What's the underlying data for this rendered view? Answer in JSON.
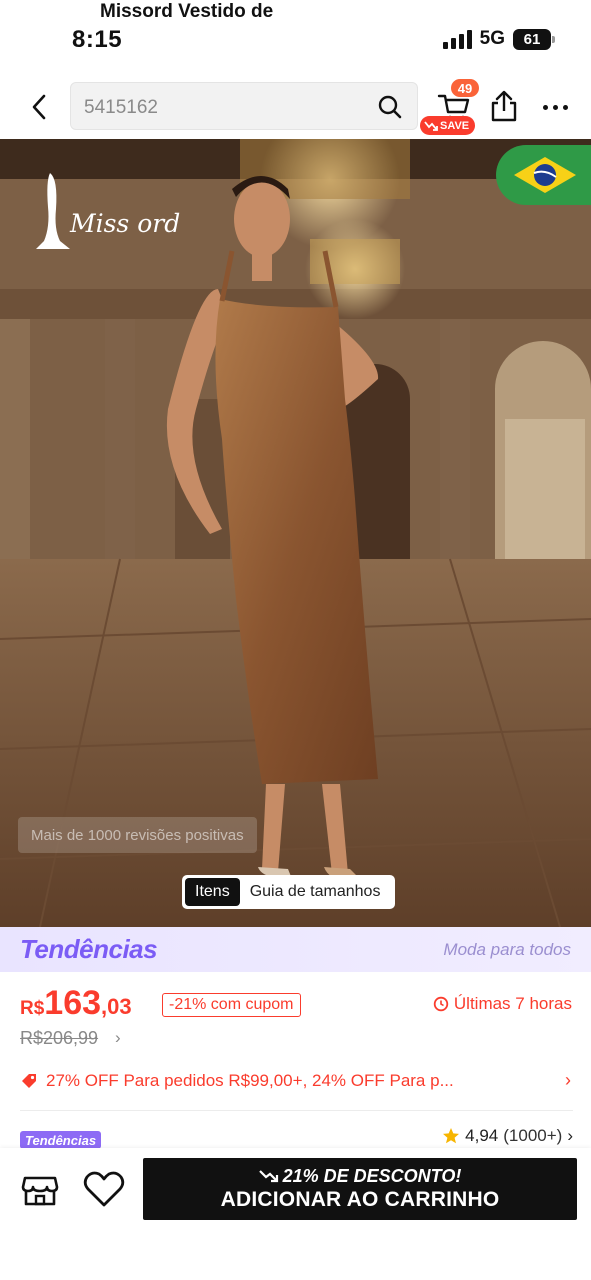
{
  "status_bar": {
    "time": "8:15",
    "network": "5G",
    "battery": "61"
  },
  "nav": {
    "search_text": "5415162",
    "cart_count": "49",
    "save_badge": "SAVE"
  },
  "hero": {
    "brand": "Miss ord",
    "reviews_text": "Mais de 1000 revisões positivas",
    "tabs": [
      "Itens",
      "Guia de tamanhos"
    ]
  },
  "trends_banner": {
    "logo": "Tendências",
    "tagline": "Moda para todos"
  },
  "price": {
    "currency": "R$",
    "integer": "163",
    "cents": ",03",
    "coupon": "-21% com cupom",
    "timer": "Últimas 7 horas",
    "original": "R$206,99",
    "original_chevron": "›"
  },
  "promo": {
    "text": "27% OFF Para pedidos R$99,00+,  24% OFF Para p...",
    "chevron": "›"
  },
  "product": {
    "tag": "Tendências",
    "title": "Missord Vestido de",
    "rating": "4,94",
    "rating_count": "(1000+)",
    "rating_chevron": "›"
  },
  "bottom_bar": {
    "discount_text": "21% DE DESCONTO!",
    "add_to_cart": "ADICIONAR AO CARRINHO"
  },
  "colors": {
    "accent": "#fa3c2d",
    "trends": "#7b5cf5",
    "button": "#111111"
  }
}
